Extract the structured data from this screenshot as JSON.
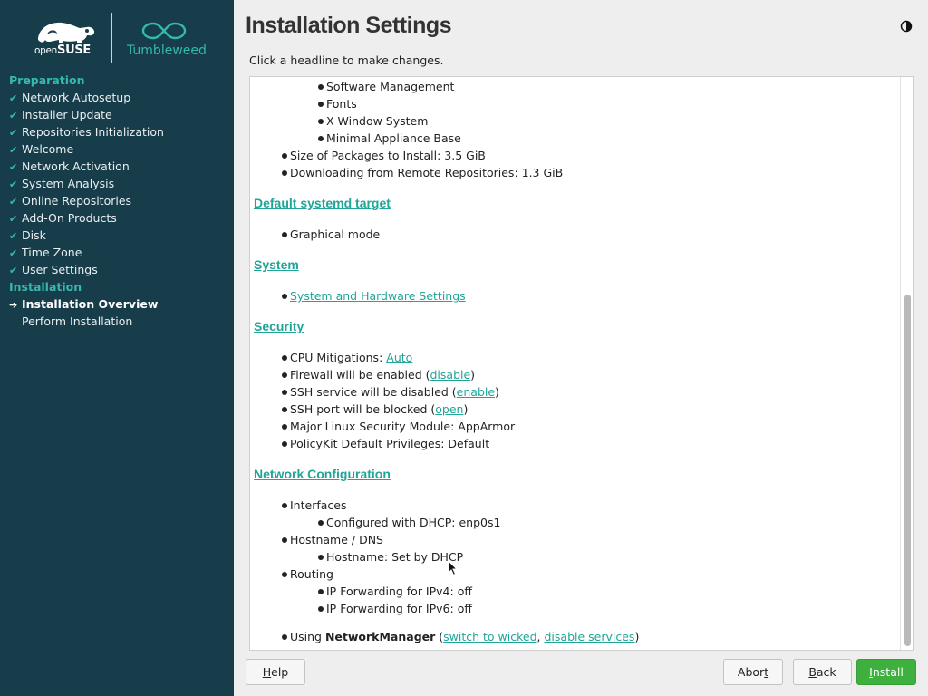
{
  "sidebar": {
    "logo_text_bold": "SUSE",
    "logo_text_light": "open",
    "product": "Tumbleweed",
    "groups": [
      {
        "label": "Preparation"
      },
      {
        "label": "Installation"
      }
    ],
    "preparation_steps": [
      "Network Autosetup",
      "Installer Update",
      "Repositories Initialization",
      "Welcome",
      "Network Activation",
      "System Analysis",
      "Online Repositories",
      "Add-On Products",
      "Disk",
      "Time Zone",
      "User Settings"
    ],
    "installation_steps": [
      "Installation Overview",
      "Perform Installation"
    ],
    "check_icon": "✔",
    "current_icon": "➔"
  },
  "header": {
    "title": "Installation Settings",
    "subtitle": "Click a headline to make changes."
  },
  "content": {
    "software_items": [
      "Software Management",
      "Fonts",
      "X Window System",
      "Minimal Appliance Base"
    ],
    "size_of_packages": "Size of Packages to Install: 3.5 GiB",
    "downloading": "Downloading from Remote Repositories: 1.3 GiB",
    "systemd": {
      "heading": "Default systemd target",
      "item": "Graphical mode"
    },
    "system": {
      "heading": "System",
      "link": "System and Hardware Settings"
    },
    "security": {
      "heading": "Security",
      "cpu_label": "CPU Mitigations: ",
      "cpu_link": "Auto",
      "firewall_text": "Firewall will be enabled (",
      "firewall_link": "disable",
      "ssh_service_text": "SSH service will be disabled (",
      "ssh_service_link": "enable",
      "ssh_port_text": "SSH port will be blocked (",
      "ssh_port_link": "open",
      "close_paren": ")",
      "lsm": "Major Linux Security Module: AppArmor",
      "polkit": "PolicyKit Default Privileges: Default"
    },
    "network": {
      "heading": "Network Configuration",
      "interfaces": "Interfaces",
      "dhcp": "Configured with DHCP: enp0s1",
      "hostname_dns": "Hostname / DNS",
      "hostname": "Hostname: Set by DHCP",
      "routing": "Routing",
      "ipv4": "IP Forwarding for IPv4: off",
      "ipv6": "IP Forwarding for IPv6: off",
      "using_prefix": "Using ",
      "using_bold": "NetworkManager",
      "using_open": " (",
      "switch_link": "switch to wicked",
      "comma": ", ",
      "disable_link": "disable services",
      "using_close": ")"
    }
  },
  "buttons": {
    "help_first": "H",
    "help_rest": "elp",
    "abort_pre": "Abor",
    "abort_u": "t",
    "back_first": "B",
    "back_rest": "ack",
    "install_first": "I",
    "install_rest": "nstall"
  },
  "colors": {
    "sidebar_bg": "#173d4b",
    "accent": "#35b9ab",
    "link": "#21a597",
    "install_button": "#3eb03e"
  }
}
